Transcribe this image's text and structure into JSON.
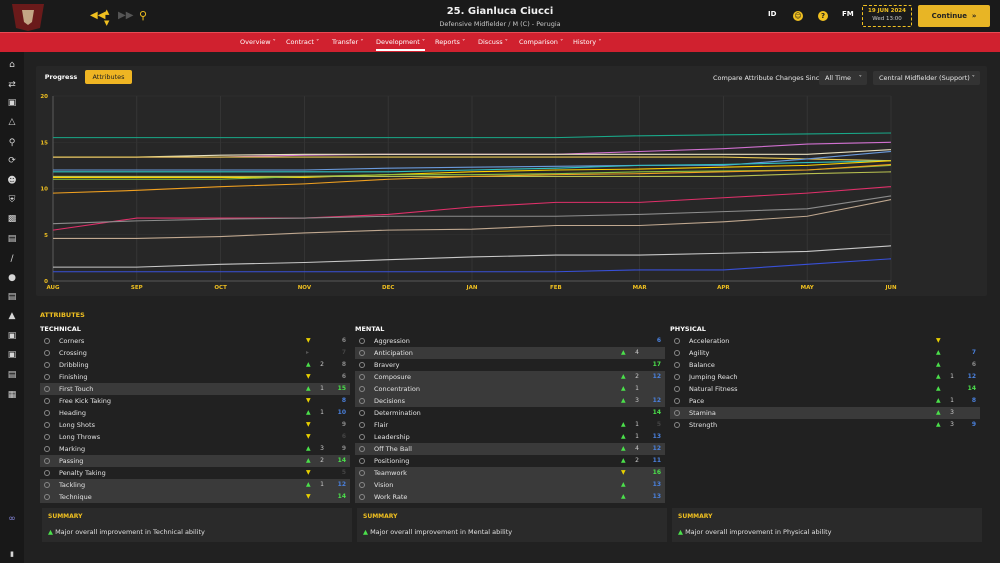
{
  "header": {
    "player_name": "25. Gianluca Ciucci",
    "player_sub": "Defensive Midfielder / M (C) - Perugia",
    "id_label": "ID",
    "fm_label": "FM",
    "help_label": "?",
    "date_line1": "19 JUN 2024",
    "date_line2": "Wed 13:00",
    "continue_label": "Continue"
  },
  "nav": {
    "items": [
      "Overview",
      "Contract",
      "Transfer",
      "Development",
      "Reports",
      "Discuss",
      "Comparison",
      "History"
    ],
    "active": "Development"
  },
  "tabs": {
    "progress": "Progress",
    "attributes": "Attributes"
  },
  "compare": {
    "label": "Compare Attribute Changes Since",
    "period": "All Time",
    "role": "Central Midfielder (Support)"
  },
  "colors": {
    "accent": "#efb523",
    "nav_red": "#d0212f",
    "up_green": "#4be04b",
    "down_yellow": "#e8d000",
    "grey": "#888888"
  },
  "chart_data": {
    "type": "line",
    "x": [
      "AUG",
      "SEP",
      "OCT",
      "NOV",
      "DEC",
      "JAN",
      "FEB",
      "MAR",
      "APR",
      "MAY",
      "JUN"
    ],
    "ylim": [
      0,
      20
    ],
    "yticks": [
      0,
      5,
      10,
      15,
      20
    ],
    "grid": true,
    "series": [
      {
        "color": "#19a889",
        "values": [
          15.5,
          15.5,
          15.5,
          15.5,
          15.5,
          15.5,
          15.5,
          15.7,
          15.8,
          15.9,
          16
        ]
      },
      {
        "color": "#d070d0",
        "values": [
          13.4,
          13.4,
          13.4,
          13.6,
          13.7,
          13.7,
          13.7,
          14,
          14.3,
          14.8,
          15
        ]
      },
      {
        "color": "#e8e0c0",
        "values": [
          13.4,
          13.4,
          13.6,
          13.7,
          13.7,
          13.7,
          13.7,
          13.7,
          13.7,
          13.7,
          14.2
        ]
      },
      {
        "color": "#e8c850",
        "values": [
          13.4,
          13.4,
          13.4,
          13.4,
          13.4,
          13.4,
          13.4,
          13.4,
          13.4,
          13.2,
          13
        ]
      },
      {
        "color": "#6a9adc",
        "values": [
          12,
          12,
          12,
          12,
          12.2,
          12.3,
          12.4,
          12.5,
          12.5,
          13.2,
          14
        ]
      },
      {
        "color": "#30c0c0",
        "values": [
          11.8,
          11.8,
          11.8,
          11.8,
          11.8,
          12,
          12.2,
          12.5,
          12.6,
          12.8,
          13
        ]
      },
      {
        "color": "#ffd000",
        "values": [
          11.2,
          11.2,
          11.2,
          11.2,
          11.5,
          11.8,
          12,
          12.1,
          12.3,
          12.5,
          13
        ]
      },
      {
        "color": "#8ac040",
        "values": [
          11,
          11,
          11,
          11.3,
          11.5,
          11.5,
          11.6,
          11.8,
          11.9,
          12,
          12.5
        ]
      },
      {
        "color": "#b8c050",
        "values": [
          11.3,
          11.3,
          11.3,
          11.3,
          11.3,
          11.3,
          11.3,
          11.3,
          11.3,
          11.6,
          11.8
        ]
      },
      {
        "color": "#f0a020",
        "values": [
          9.5,
          9.8,
          10.2,
          10.5,
          11,
          11.3,
          11.5,
          11.6,
          11.8,
          12,
          12.6
        ]
      },
      {
        "color": "#e0306a",
        "values": [
          5.5,
          6.8,
          6.8,
          6.8,
          7.2,
          8,
          8.5,
          8.5,
          9,
          9.5,
          10.2
        ]
      },
      {
        "color": "#8c8c8c",
        "values": [
          6.2,
          6.5,
          6.7,
          6.8,
          7,
          7,
          7,
          7.2,
          7.5,
          7.8,
          9.2
        ]
      },
      {
        "color": "#c0a890",
        "values": [
          4.6,
          4.6,
          4.8,
          5.2,
          5.5,
          5.6,
          6,
          6,
          6.4,
          7,
          8.8
        ]
      },
      {
        "color": "#c8c8c8",
        "values": [
          1.5,
          1.5,
          1.8,
          2,
          2.3,
          2.6,
          2.8,
          2.8,
          3,
          3.2,
          3.8
        ]
      },
      {
        "color": "#3850d8",
        "values": [
          1,
          1,
          1,
          1,
          1,
          1,
          1,
          1.2,
          1.2,
          1.8,
          2.4
        ]
      }
    ]
  },
  "attributes_title": "ATTRIBUTES",
  "technical": {
    "title": "TECHNICAL",
    "rows": [
      {
        "name": "Corners",
        "dir": "down",
        "change": "",
        "value": "6",
        "vc": "#888888"
      },
      {
        "name": "Crossing",
        "dir": "flat",
        "change": "",
        "value": "7",
        "vc": "#444444"
      },
      {
        "name": "Dribbling",
        "dir": "up",
        "change": "2",
        "value": "8",
        "vc": "#888888"
      },
      {
        "name": "Finishing",
        "dir": "down",
        "change": "",
        "value": "6",
        "vc": "#888888"
      },
      {
        "name": "First Touch",
        "dir": "up",
        "change": "1",
        "value": "15",
        "vc": "#4be04b",
        "hl": true
      },
      {
        "name": "Free Kick Taking",
        "dir": "down",
        "change": "",
        "value": "8",
        "vc": "#4a80dc"
      },
      {
        "name": "Heading",
        "dir": "up",
        "change": "1",
        "value": "10",
        "vc": "#4a80dc"
      },
      {
        "name": "Long Shots",
        "dir": "down",
        "change": "",
        "value": "9",
        "vc": "#888888"
      },
      {
        "name": "Long Throws",
        "dir": "down",
        "change": "",
        "value": "6",
        "vc": "#444444"
      },
      {
        "name": "Marking",
        "dir": "up",
        "change": "3",
        "value": "9",
        "vc": "#888888"
      },
      {
        "name": "Passing",
        "dir": "up",
        "change": "2",
        "value": "14",
        "vc": "#4be04b",
        "hl": true
      },
      {
        "name": "Penalty Taking",
        "dir": "down",
        "change": "",
        "value": "5",
        "vc": "#444444"
      },
      {
        "name": "Tackling",
        "dir": "up",
        "change": "1",
        "value": "12",
        "vc": "#4a80dc",
        "hl": true
      },
      {
        "name": "Technique",
        "dir": "down",
        "change": "",
        "value": "14",
        "vc": "#4be04b",
        "hl": true
      }
    ]
  },
  "mental": {
    "title": "MENTAL",
    "rows": [
      {
        "name": "Aggression",
        "dir": "none",
        "change": "",
        "value": "6",
        "vc": "#4a80dc"
      },
      {
        "name": "Anticipation",
        "dir": "up",
        "change": "4",
        "value": "",
        "vc": "#888888",
        "hl": true
      },
      {
        "name": "Bravery",
        "dir": "none",
        "change": "",
        "value": "17",
        "vc": "#4be04b"
      },
      {
        "name": "Composure",
        "dir": "up",
        "change": "2",
        "value": "12",
        "vc": "#4a80dc",
        "hl": true
      },
      {
        "name": "Concentration",
        "dir": "up",
        "change": "1",
        "value": "",
        "vc": "#888888",
        "hl": true
      },
      {
        "name": "Decisions",
        "dir": "up",
        "change": "3",
        "value": "12",
        "vc": "#4a80dc",
        "hl": true
      },
      {
        "name": "Determination",
        "dir": "none",
        "change": "",
        "value": "14",
        "vc": "#4be04b"
      },
      {
        "name": "Flair",
        "dir": "up",
        "change": "1",
        "value": "5",
        "vc": "#444444"
      },
      {
        "name": "Leadership",
        "dir": "up",
        "change": "1",
        "value": "13",
        "vc": "#4a80dc"
      },
      {
        "name": "Off The Ball",
        "dir": "up",
        "change": "4",
        "value": "12",
        "vc": "#4a80dc",
        "hl": true
      },
      {
        "name": "Positioning",
        "dir": "up",
        "change": "2",
        "value": "11",
        "vc": "#4a80dc"
      },
      {
        "name": "Teamwork",
        "dir": "down",
        "change": "",
        "value": "16",
        "vc": "#4be04b",
        "hl": true
      },
      {
        "name": "Vision",
        "dir": "up",
        "change": "",
        "value": "13",
        "vc": "#4a80dc",
        "hl": true
      },
      {
        "name": "Work Rate",
        "dir": "up",
        "change": "",
        "value": "13",
        "vc": "#4a80dc",
        "hl": true
      }
    ]
  },
  "physical": {
    "title": "PHYSICAL",
    "rows": [
      {
        "name": "Acceleration",
        "dir": "down",
        "change": "",
        "value": "",
        "vc": "#888888"
      },
      {
        "name": "Agility",
        "dir": "up",
        "change": "",
        "value": "7",
        "vc": "#4a80dc"
      },
      {
        "name": "Balance",
        "dir": "up",
        "change": "",
        "value": "6",
        "vc": "#888888"
      },
      {
        "name": "Jumping Reach",
        "dir": "up",
        "change": "1",
        "value": "12",
        "vc": "#4a80dc"
      },
      {
        "name": "Natural Fitness",
        "dir": "up",
        "change": "",
        "value": "14",
        "vc": "#4be04b"
      },
      {
        "name": "Pace",
        "dir": "up",
        "change": "1",
        "value": "8",
        "vc": "#4a80dc"
      },
      {
        "name": "Stamina",
        "dir": "up",
        "change": "3",
        "value": "",
        "vc": "#888888",
        "hl": true
      },
      {
        "name": "Strength",
        "dir": "up",
        "change": "3",
        "value": "9",
        "vc": "#4a80dc"
      }
    ]
  },
  "summary": {
    "title": "SUMMARY",
    "tech_prefix": "Major overall improvement in ",
    "tech_text": "Technical ability",
    "mental_prefix": "Major overall improvement in ",
    "mental_text": "Mental ability",
    "phys_prefix": "Major overall improvement in ",
    "phys_text": "Physical ability"
  }
}
